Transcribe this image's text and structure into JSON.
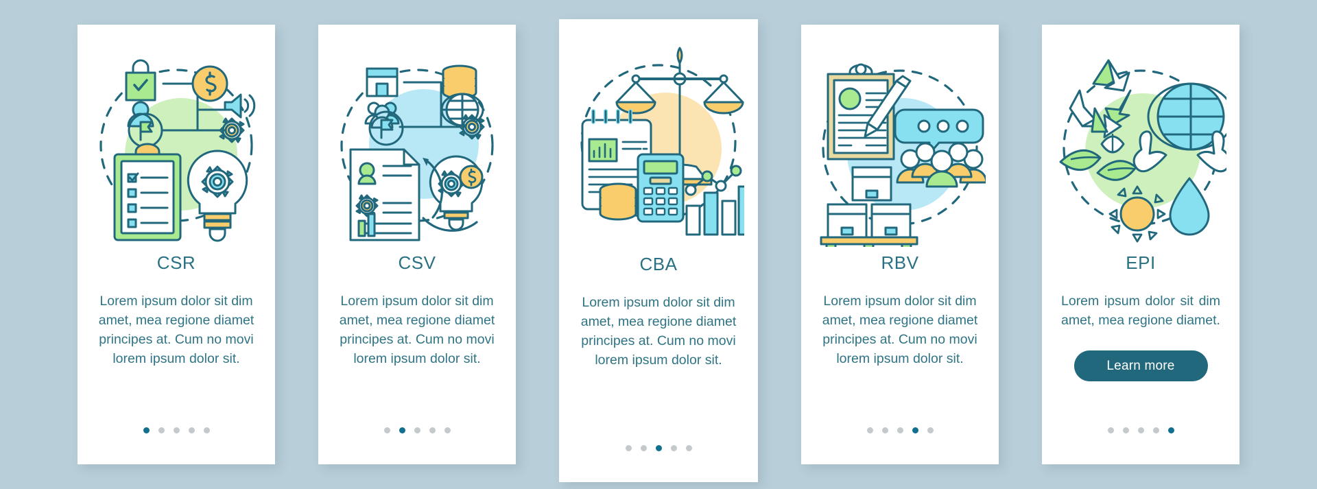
{
  "theme": {
    "background": "#b8ced8",
    "card_background": "#ffffff",
    "title_color": "#2a7183",
    "body_color": "#2f7484",
    "button_color": "#21687d",
    "button_text_color": "#ffffff",
    "dot_active_color": "#11708d",
    "dot_inactive_color": "#c4c9cc",
    "outline_color": "#21687d",
    "green": "#8fdc8a",
    "light_green": "#c9f0bd",
    "cyan": "#86e0f0",
    "light_cyan": "#b8e8f5",
    "yellow": "#f9cd6b",
    "light_yellow": "#fbe3b2"
  },
  "cards": [
    {
      "id": "csr",
      "illustration": "csr-strategy-illustration",
      "title": "CSR",
      "body": "Lorem ipsum dolor sit dim amet, mea regione diamet principes at. Cum no movi lorem ipsum dolor sit.",
      "dots": {
        "count": 5,
        "active_index": 0
      },
      "has_button": false,
      "button_label": ""
    },
    {
      "id": "csv",
      "illustration": "csv-shared-value-illustration",
      "title": "CSV",
      "body": "Lorem ipsum dolor sit dim amet, mea regione diamet principes at. Cum no movi lorem ipsum dolor sit.",
      "dots": {
        "count": 5,
        "active_index": 1
      },
      "has_button": false,
      "button_label": ""
    },
    {
      "id": "cba",
      "illustration": "cba-cost-benefit-illustration",
      "title": "CBA",
      "body": "Lorem ipsum dolor sit dim amet, mea regione diamet principes at. Cum no movi lorem ipsum dolor sit.",
      "dots": {
        "count": 5,
        "active_index": 2
      },
      "has_button": false,
      "button_label": ""
    },
    {
      "id": "rbv",
      "illustration": "rbv-resource-based-illustration",
      "title": "RBV",
      "body": "Lorem ipsum dolor sit dim amet, mea regione diamet principes at. Cum no movi lorem ipsum dolor sit.",
      "dots": {
        "count": 5,
        "active_index": 3
      },
      "has_button": false,
      "button_label": ""
    },
    {
      "id": "epi",
      "illustration": "epi-environmental-illustration",
      "title": "EPI",
      "body": "Lorem ipsum dolor sit dim amet, mea regione diamet.",
      "dots": {
        "count": 5,
        "active_index": 4
      },
      "has_button": true,
      "button_label": "Learn more"
    }
  ]
}
